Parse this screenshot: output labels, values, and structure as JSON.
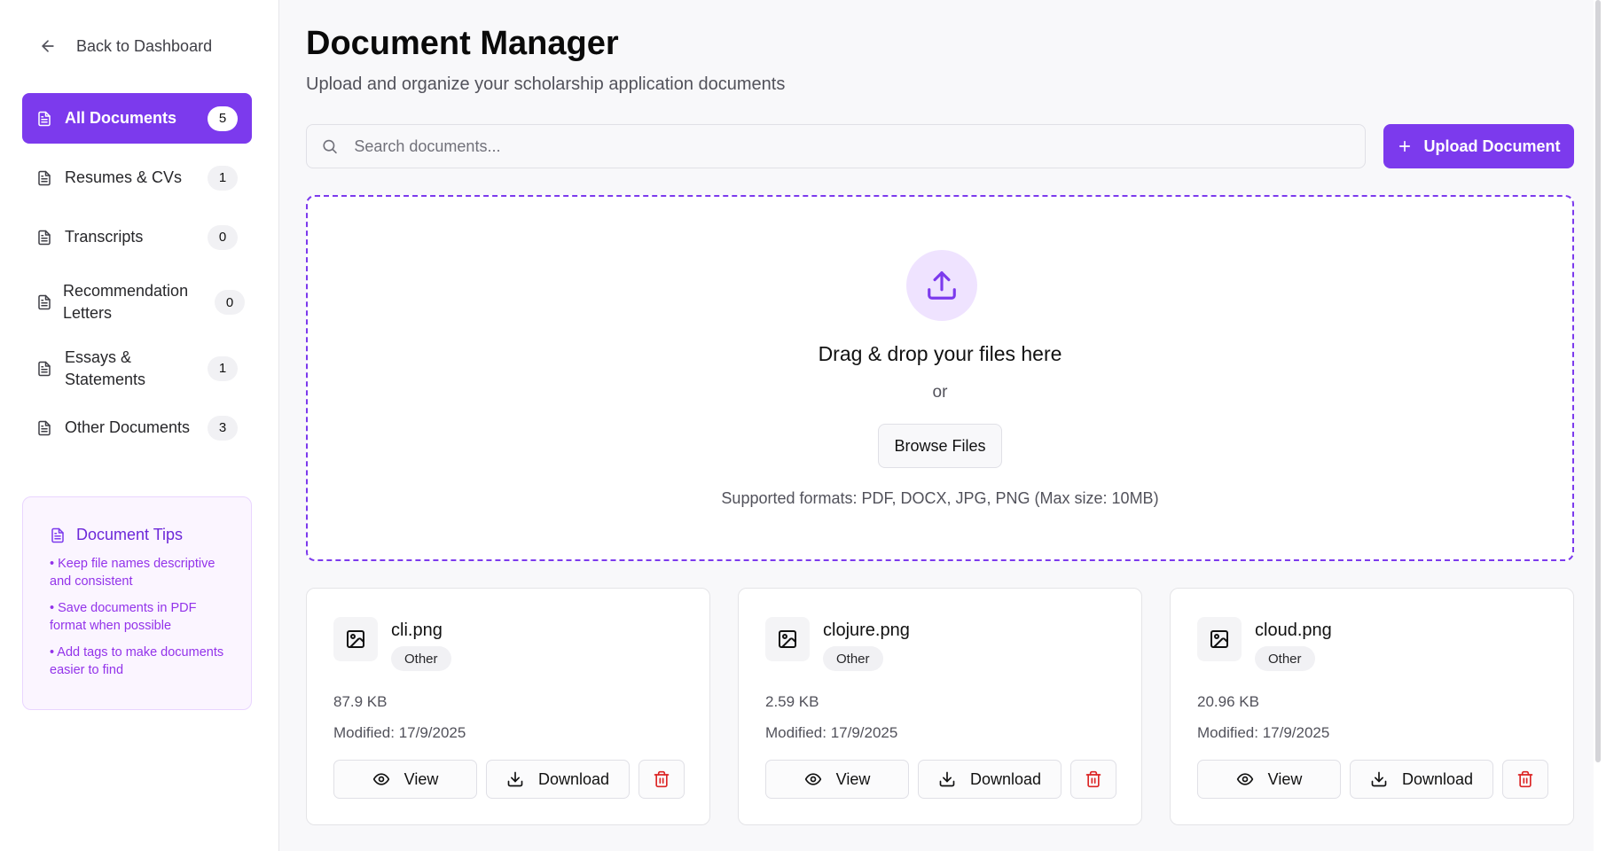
{
  "sidebar": {
    "back_label": "Back to Dashboard",
    "items": [
      {
        "label": "All Documents",
        "count": "5",
        "active": true
      },
      {
        "label": "Resumes & CVs",
        "count": "1"
      },
      {
        "label": "Transcripts",
        "count": "0"
      },
      {
        "label": "Recommendation Letters",
        "count": "0"
      },
      {
        "label": "Essays & Statements",
        "count": "1"
      },
      {
        "label": "Other Documents",
        "count": "3"
      }
    ],
    "tips": {
      "title": "Document Tips",
      "items": [
        "• Keep file names descriptive and consistent",
        "• Save documents in PDF format when possible",
        "• Add tags to make documents easier to find"
      ]
    }
  },
  "main": {
    "title": "Document Manager",
    "subtitle": "Upload and organize your scholarship application documents",
    "search": {
      "placeholder": "Search documents..."
    },
    "upload_button": "Upload Document",
    "dropzone": {
      "title": "Drag & drop your files here",
      "or": "or",
      "browse_label": "Browse Files",
      "formats": "Supported formats: PDF, DOCX, JPG, PNG (Max size: 10MB)"
    },
    "files": [
      {
        "name": "cli.png",
        "tag": "Other",
        "size": "87.9 KB",
        "modified": "Modified: 17/9/2025"
      },
      {
        "name": "clojure.png",
        "tag": "Other",
        "size": "2.59 KB",
        "modified": "Modified: 17/9/2025"
      },
      {
        "name": "cloud.png",
        "tag": "Other",
        "size": "20.96 KB",
        "modified": "Modified: 17/9/2025"
      }
    ],
    "file_actions": {
      "view": "View",
      "download": "Download"
    }
  },
  "colors": {
    "accent": "#7c3aed",
    "danger": "#dc2626",
    "tips_text": "#9333ea"
  }
}
